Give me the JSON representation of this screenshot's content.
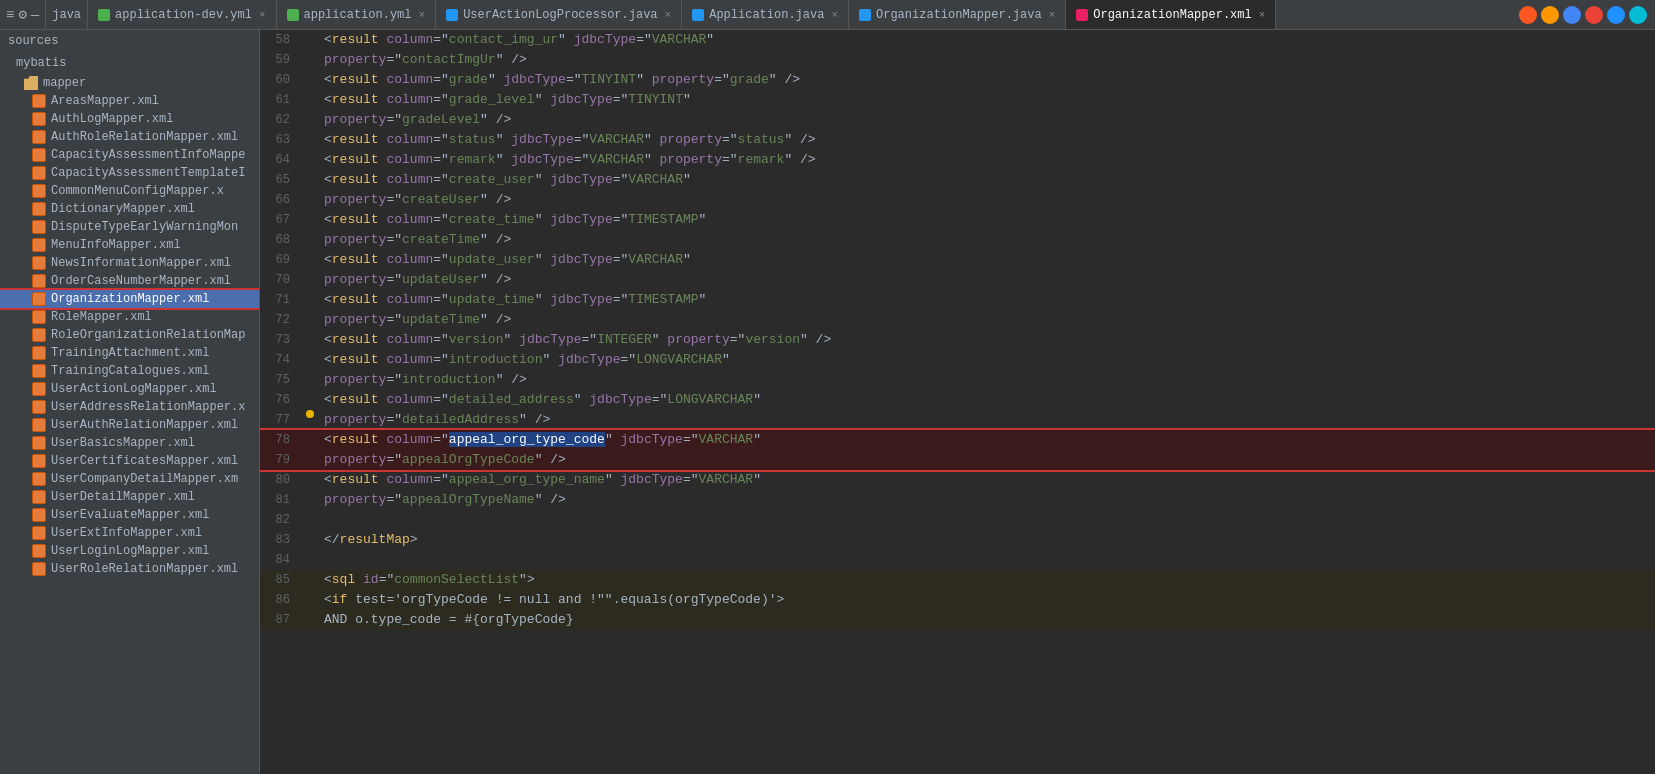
{
  "tabBar": {
    "leftIcons": [
      "≡",
      "⚙",
      "—"
    ],
    "javaLabel": "java",
    "tabs": [
      {
        "id": "app-dev",
        "label": "application-dev.yml",
        "iconColor": "green",
        "active": false
      },
      {
        "id": "app-yml",
        "label": "application.yml",
        "iconColor": "green",
        "active": false
      },
      {
        "id": "user-action",
        "label": "UserActionLogProcessor.java",
        "iconColor": "blue",
        "active": false
      },
      {
        "id": "application-java",
        "label": "Application.java",
        "iconColor": "blue",
        "active": false
      },
      {
        "id": "org-mapper-java",
        "label": "OrganizationMapper.java",
        "iconColor": "blue",
        "active": false
      },
      {
        "id": "org-mapper-xml",
        "label": "OrganizationMapper.xml",
        "iconColor": "xml",
        "active": true
      }
    ],
    "browserIcons": [
      "🟠",
      "🦊",
      "🔵",
      "🔴",
      "🔵",
      "🔵"
    ]
  },
  "sidebar": {
    "sections": [
      {
        "label": "sources",
        "indent": 0
      },
      {
        "label": "mybatis",
        "indent": 1
      },
      {
        "label": "mapper",
        "isFolder": true,
        "indent": 2
      }
    ],
    "files": [
      {
        "name": "AreasMapper.xml",
        "selected": false
      },
      {
        "name": "AuthLogMapper.xml",
        "selected": false
      },
      {
        "name": "AuthRoleRelationMapper.xml",
        "selected": false
      },
      {
        "name": "CapacityAssessmentInfoMappe",
        "selected": false
      },
      {
        "name": "CapacityAssessmentTemplateI",
        "selected": false
      },
      {
        "name": "CommonMenuConfigMapper.x",
        "selected": false
      },
      {
        "name": "DictionaryMapper.xml",
        "selected": false
      },
      {
        "name": "DisputeTypeEarlyWarningMon",
        "selected": false
      },
      {
        "name": "MenuInfoMapper.xml",
        "selected": false
      },
      {
        "name": "NewsInformationMapper.xml",
        "selected": false
      },
      {
        "name": "OrderCaseNumberMapper.xml",
        "selected": false
      },
      {
        "name": "OrganizationMapper.xml",
        "selected": true
      },
      {
        "name": "RoleMapper.xml",
        "selected": false
      },
      {
        "name": "RoleOrganizationRelationMap",
        "selected": false
      },
      {
        "name": "TrainingAttachment.xml",
        "selected": false
      },
      {
        "name": "TrainingCatalogues.xml",
        "selected": false
      },
      {
        "name": "UserActionLogMapper.xml",
        "selected": false
      },
      {
        "name": "UserAddressRelationMapper.x",
        "selected": false
      },
      {
        "name": "UserAuthRelationMapper.xml",
        "selected": false
      },
      {
        "name": "UserBasicsMapper.xml",
        "selected": false
      },
      {
        "name": "UserCertificatesMapper.xml",
        "selected": false
      },
      {
        "name": "UserCompanyDetailMapper.xm",
        "selected": false
      },
      {
        "name": "UserDetailMapper.xml",
        "selected": false
      },
      {
        "name": "UserEvaluateMapper.xml",
        "selected": false
      },
      {
        "name": "UserExtInfoMapper.xml",
        "selected": false
      },
      {
        "name": "UserLoginLogMapper.xml",
        "selected": false
      },
      {
        "name": "UserRoleRelationMapper.xml",
        "selected": false
      }
    ]
  },
  "codeLines": [
    {
      "num": 58,
      "indent": 2,
      "content": "<result column=\"contact_img_ur\" jdbcType=\"VARCHAR\""
    },
    {
      "num": 59,
      "indent": 3,
      "content": "property=\"contactImgUr\" />"
    },
    {
      "num": 60,
      "indent": 2,
      "content": "<result column=\"grade\" jdbcType=\"TINYINT\" property=\"grade\" />"
    },
    {
      "num": 61,
      "indent": 2,
      "content": "<result column=\"grade_level\" jdbcType=\"TINYINT\""
    },
    {
      "num": 62,
      "indent": 3,
      "content": "property=\"gradeLevel\" />"
    },
    {
      "num": 63,
      "indent": 2,
      "content": "<result column=\"status\" jdbcType=\"VARCHAR\" property=\"status\" />"
    },
    {
      "num": 64,
      "indent": 2,
      "content": "<result column=\"remark\" jdbcType=\"VARCHAR\" property=\"remark\" />"
    },
    {
      "num": 65,
      "indent": 2,
      "content": "<result column=\"create_user\" jdbcType=\"VARCHAR\""
    },
    {
      "num": 66,
      "indent": 3,
      "content": "property=\"createUser\" />"
    },
    {
      "num": 67,
      "indent": 2,
      "content": "<result column=\"create_time\" jdbcType=\"TIMESTAMP\""
    },
    {
      "num": 68,
      "indent": 3,
      "content": "property=\"createTime\" />"
    },
    {
      "num": 69,
      "indent": 2,
      "content": "<result column=\"update_user\" jdbcType=\"VARCHAR\""
    },
    {
      "num": 70,
      "indent": 3,
      "content": "property=\"updateUser\" />"
    },
    {
      "num": 71,
      "indent": 2,
      "content": "<result column=\"update_time\" jdbcType=\"TIMESTAMP\""
    },
    {
      "num": 72,
      "indent": 3,
      "content": "property=\"updateTime\" />"
    },
    {
      "num": 73,
      "indent": 2,
      "content": "<result column=\"version\" jdbcType=\"INTEGER\" property=\"version\" />"
    },
    {
      "num": 74,
      "indent": 2,
      "content": "<result column=\"introduction\" jdbcType=\"LONGVARCHAR\""
    },
    {
      "num": 75,
      "indent": 3,
      "content": "property=\"introduction\" />"
    },
    {
      "num": 76,
      "indent": 2,
      "content": "<result column=\"detailed_address\" jdbcType=\"LONGVARCHAR\""
    },
    {
      "num": 77,
      "indent": 3,
      "content": "property=\"detailedAddress\" />",
      "hasWarning": true
    },
    {
      "num": 78,
      "indent": 2,
      "content": "<result column=\"appeal_org_type_code\" jdbcType=\"VARCHAR\"",
      "highlighted": true,
      "redBox": true
    },
    {
      "num": 79,
      "indent": 3,
      "content": "property=\"appealOrgTypeCode\" />",
      "highlighted": true,
      "redBox": true
    },
    {
      "num": 80,
      "indent": 2,
      "content": "<result column=\"appeal_org_type_name\" jdbcType=\"VARCHAR\""
    },
    {
      "num": 81,
      "indent": 3,
      "content": "property=\"appealOrgTypeName\" />"
    },
    {
      "num": 82,
      "indent": 0,
      "content": ""
    },
    {
      "num": 83,
      "indent": 2,
      "content": "</resultMap>"
    },
    {
      "num": 84,
      "indent": 0,
      "content": ""
    },
    {
      "num": 85,
      "indent": 1,
      "content": "<sql id=\"commonSelectList\">",
      "bgLight": true
    },
    {
      "num": 86,
      "indent": 2,
      "content": "<if test='orgTypeCode != null and !\"\".equals(orgTypeCode)'>",
      "bgLight": true
    },
    {
      "num": 87,
      "indent": 3,
      "content": "AND o.type_code = #{orgTypeCode}",
      "bgLight": true
    }
  ]
}
